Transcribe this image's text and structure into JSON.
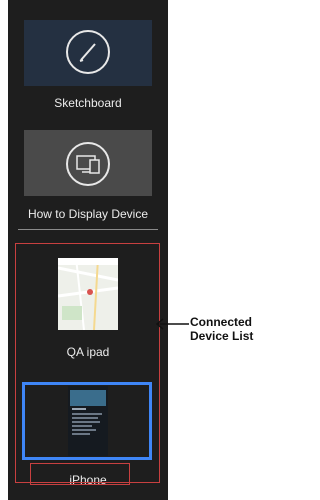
{
  "sidebar": {
    "items": [
      {
        "label": "Sketchboard",
        "icon": "pencil-icon"
      },
      {
        "label": "How to Display Device",
        "icon": "devices-icon"
      }
    ],
    "connected_devices": [
      {
        "label": "QA ipad"
      },
      {
        "label": "iPhone"
      }
    ]
  },
  "annotation": {
    "callout_line1": "Connected",
    "callout_line2": "Device List"
  },
  "colors": {
    "sidebar_bg": "#1e1e1e",
    "tile_blue": "#243041",
    "tile_gray": "#4a4a4a",
    "annotation_red": "#c84040",
    "selection_blue": "#3f86f7"
  }
}
